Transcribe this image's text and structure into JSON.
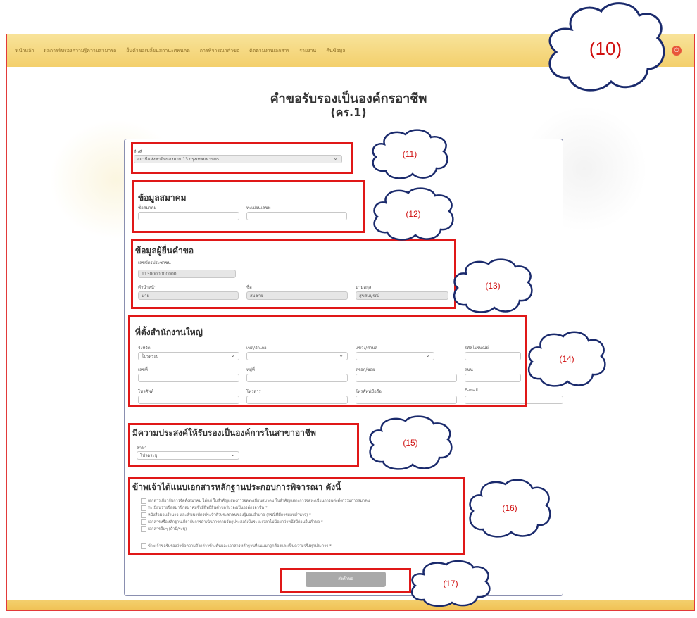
{
  "nav": {
    "items": [
      "หน้าหลัก",
      "ผลการรับรองความรู้ความสามารถ",
      "ยื่นคำขอเปลี่ยนสถานะศพนคด",
      "การพิจารณาคำขอ",
      "ติดตามงานเอกสาร",
      "รายงาน",
      "คืนข้อมูล"
    ],
    "logout_icon": "power-icon"
  },
  "page": {
    "title": "คำขอรับรองเป็นองค์กรอาชีพ",
    "subtitle": "(คร.1)"
  },
  "sections": {
    "office": {
      "label": "ยื่นที่",
      "value": "สถานีแห่งชาติหนองคาย 13 กรุงเทพมหานคร"
    },
    "association": {
      "heading": "ข้อมูลสมาคม",
      "name_label": "ชื่อสมาคม",
      "reg_label": "ทะเบียนเลขที่"
    },
    "applicant": {
      "heading": "ข้อมูลผู้ยื่นคำขอ",
      "id_label": "เลขบัตรประชาชน",
      "id_value": "1130000000000",
      "prefix_label": "คำนำหน้า",
      "prefix_value": "นาย",
      "first_label": "ชื่อ",
      "first_value": "สมชาย",
      "last_label": "นามสกุล",
      "last_value": "สุขสมบูรณ์"
    },
    "hq": {
      "heading": "ที่ตั้งสำนักงานใหญ่",
      "province_label": "จังหวัด",
      "province_value": "โปรดระบุ",
      "district_label": "เขต/อำเภอ",
      "subdistrict_label": "แขวง/ตำบล",
      "postal_label": "รหัสไปรษณีย์",
      "no_label": "เลขที่",
      "moo_label": "หมู่ที่",
      "soi_label": "ตรอก/ซอย",
      "road_label": "ถนน",
      "phone_label": "โทรศัพท์",
      "fax_label": "โทรสาร",
      "mobile_label": "โทรศัพท์มือถือ",
      "email_label": "E-mail"
    },
    "purpose": {
      "heading": "มีความประสงค์ให้รับรองเป็นองค์การในสาขาอาชีพ",
      "branch_label": "สาขา",
      "branch_value": "โปรดระบุ"
    },
    "documents": {
      "heading": "ข้าพเจ้าได้แนบเอกสารหลักฐานประกอบการพิจารณา ดังนี้",
      "items": [
        "เอกสารเกี่ยวกับการจัดตั้งสมาคม ได้แก่ ใบสำคัญแสดงการจดทะเบียนสมาคม ใบสำคัญแสดงการจดทะเบียนการแต่งตั้งกรรมการสมาคม",
        "ทะเบียนรายชื่อสมาชิกสมาคมซึ่งมีสิทธิ์ยื่นคำขอรับรองเป็นองค์กรอาชีพ *",
        "หนังสือมอบอำนาจ และสำเนาบัตรประจำตัวประชาชนของผู้มอบอำนาจ (กรณีที่มีการมอบอำนาจ) *",
        "เอกสารหรือหลักฐานเกี่ยวกับการดำเนินการตามวัตถุประสงค์เป็นระยะเวลาไม่น้อยกว่าหนึ่งปีก่อนยื่นคำขอ *",
        "เอกสารอื่นๆ (ถ้ามี/ระบุ)"
      ],
      "certify": "ข้าพเจ้าขอรับรองว่าข้อความดังกล่าวข้างต้นและเอกสารหลักฐานที่แนบมาถูกต้องและเป็นความจริงทุกประการ *"
    },
    "submit_label": "ส่งคำขอ"
  },
  "callouts": [
    "(10)",
    "(11)",
    "(12)",
    "(13)",
    "(14)",
    "(15)",
    "(16)",
    "(17)"
  ],
  "colors": {
    "highlight": "#e01818",
    "header": "#f3cf6c",
    "button": "#a9a9a9"
  }
}
